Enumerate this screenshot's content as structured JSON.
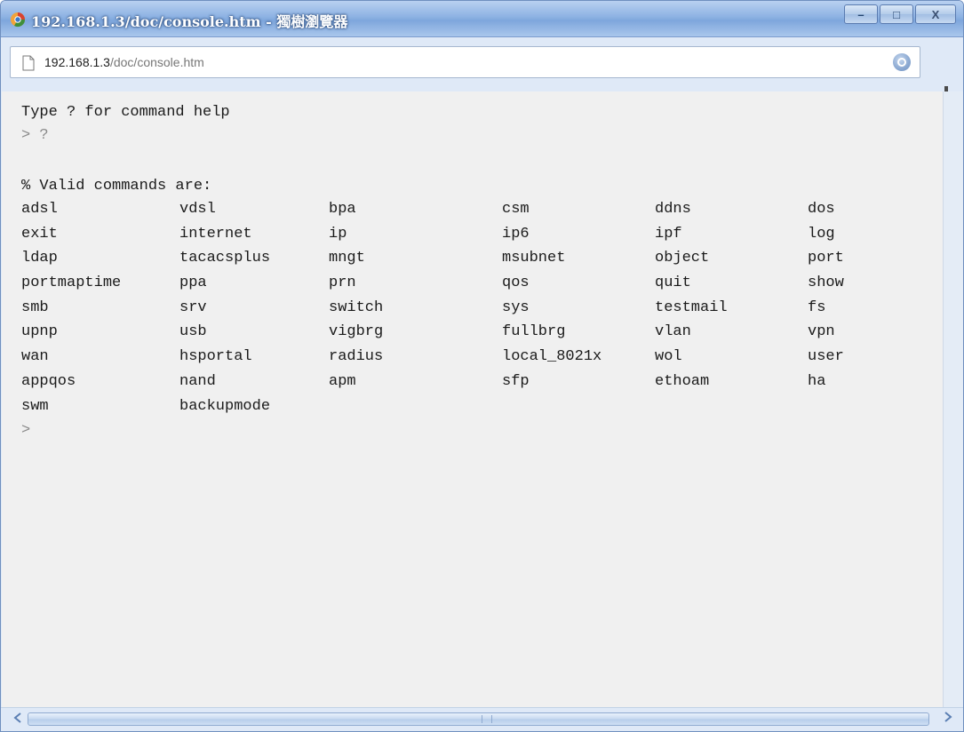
{
  "window": {
    "title": "192.168.1.3/doc/console.htm - 獨樹瀏覽器",
    "controls": {
      "minimize": "–",
      "maximize": "□",
      "close": "X"
    }
  },
  "address": {
    "host": "192.168.1.3",
    "path": "/doc/console.htm"
  },
  "icons": {
    "app": "browser-app-icon",
    "page": "page-icon",
    "shield": "shield-icon",
    "download": "download-icon",
    "scroll_left": "scroll-left-arrow-icon",
    "scroll_right": "scroll-right-arrow-icon"
  },
  "console": {
    "help_line": "Type ? for command help",
    "prompt_query": "> ?",
    "valid_header": "% Valid commands are:",
    "commands": [
      [
        "adsl",
        "vdsl",
        "bpa",
        "csm",
        "ddns",
        "dos"
      ],
      [
        "exit",
        "internet",
        "ip",
        "ip6",
        "ipf",
        "log"
      ],
      [
        "ldap",
        "tacacsplus",
        "mngt",
        "msubnet",
        "object",
        "port"
      ],
      [
        "portmaptime",
        "ppa",
        "prn",
        "qos",
        "quit",
        "show"
      ],
      [
        "smb",
        "srv",
        "switch",
        "sys",
        "testmail",
        "fs"
      ],
      [
        "upnp",
        "usb",
        "vigbrg",
        "fullbrg",
        "vlan",
        "vpn"
      ],
      [
        "wan",
        "hsportal",
        "radius",
        "local_8021x",
        "wol",
        "user"
      ],
      [
        "appqos",
        "nand",
        "apm",
        "sfp",
        "ethoam",
        "ha"
      ],
      [
        "swm",
        "backupmode"
      ]
    ],
    "prompt_end": ">"
  },
  "colors": {
    "titlebar": "#8db2e3",
    "console_bg": "#f0f0f0",
    "console_text": "#1a1a1a"
  }
}
